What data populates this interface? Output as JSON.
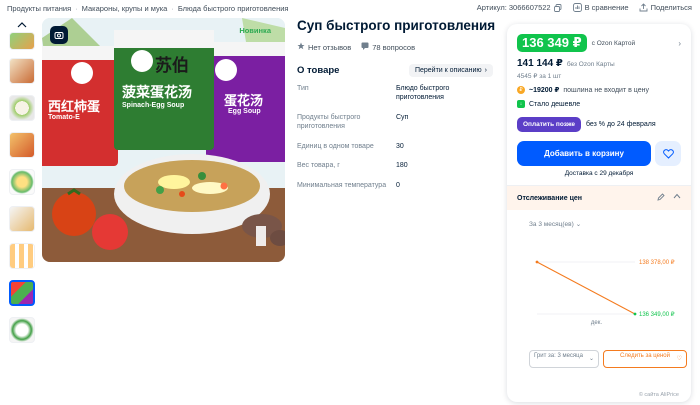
{
  "breadcrumb": [
    "Продукты питания",
    "Макароны, крупы и мука",
    "Блюда быстрого приготовления"
  ],
  "top_actions": {
    "article": "Артикул: 3066607522",
    "compare": "В сравнение",
    "share": "Поделиться"
  },
  "product": {
    "title": "Суп быстрого приготовления",
    "reviews": "Нет отзывов",
    "questions": "78 вопросов",
    "badge": "Новинка",
    "image_text": {
      "brand": "苏伯",
      "left_pack": "西红柿蛋",
      "left_pack_latin": "Tomato-E",
      "center_pack": "菠菜蛋花汤",
      "center_pack_latin": "Spinach-Egg Soup",
      "right_pack": "蛋花汤",
      "right_pack_latin": "Egg Soup"
    }
  },
  "about": {
    "title": "О товаре",
    "button": "Перейти к описанию",
    "specs": [
      {
        "key": "Тип",
        "value": "Блюдо быстрого приготовления"
      },
      {
        "key": "Продукты быстрого приготовления",
        "value": "Суп"
      },
      {
        "key": "Единиц в одном товаре",
        "value": "30"
      },
      {
        "key": "Вес товара, г",
        "value": "180"
      },
      {
        "key": "Минимальная температура",
        "value": "0"
      }
    ]
  },
  "buy": {
    "price_card": "136 349 ₽",
    "price_card_note": "с Ozon Картой",
    "price_regular": "141 144 ₽",
    "price_regular_note": "без Ozon Карты",
    "per_unit": "4545 ₽ за 1 шт",
    "duty": "~19200 ₽",
    "duty_note": "пошлина не входит в цену",
    "cheaper": "Стало дешевле",
    "pay_later_btn": "Оплатить позже",
    "pay_later_text": "без % до 24 февраля",
    "add_to_cart": "Добавить в корзину",
    "delivery": "Доставка с 29 декабря"
  },
  "tracking": {
    "title": "Отслеживание цен",
    "period": "За 3 месяц(ев)",
    "select_label": "Грит за: 3 месяца",
    "follow_label": "Следить за ценой",
    "source": "© сайта AliPrice"
  },
  "chart_data": {
    "type": "line",
    "x": [
      "",
      "дек."
    ],
    "series": [
      {
        "values": [
          138378,
          136349
        ]
      }
    ],
    "labels": [
      "138 378,00 ₽",
      "136 349,00 ₽"
    ],
    "xlabel": "дек.",
    "colors": {
      "line": "#f47b1f",
      "start": "#f47b1f",
      "end": "#10c44c"
    }
  },
  "colors": {
    "accent": "#005bff",
    "price": "#10c44c",
    "orange": "#f47b1f",
    "later": "#5b3ec7"
  }
}
